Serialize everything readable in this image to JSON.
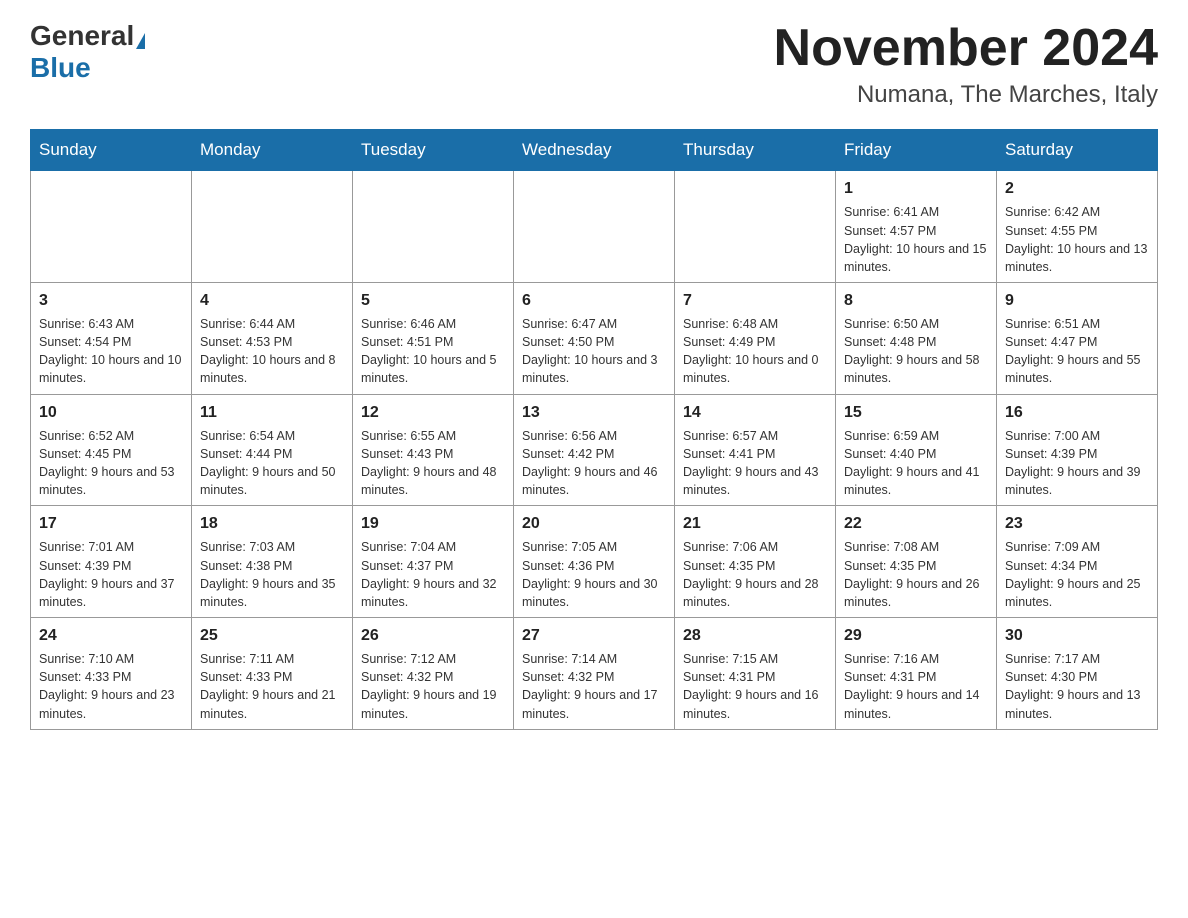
{
  "header": {
    "logo_general": "General",
    "logo_blue": "Blue",
    "month_year": "November 2024",
    "location": "Numana, The Marches, Italy"
  },
  "weekdays": [
    "Sunday",
    "Monday",
    "Tuesday",
    "Wednesday",
    "Thursday",
    "Friday",
    "Saturday"
  ],
  "weeks": [
    [
      {
        "day": "",
        "sunrise": "",
        "sunset": "",
        "daylight": ""
      },
      {
        "day": "",
        "sunrise": "",
        "sunset": "",
        "daylight": ""
      },
      {
        "day": "",
        "sunrise": "",
        "sunset": "",
        "daylight": ""
      },
      {
        "day": "",
        "sunrise": "",
        "sunset": "",
        "daylight": ""
      },
      {
        "day": "",
        "sunrise": "",
        "sunset": "",
        "daylight": ""
      },
      {
        "day": "1",
        "sunrise": "Sunrise: 6:41 AM",
        "sunset": "Sunset: 4:57 PM",
        "daylight": "Daylight: 10 hours and 15 minutes."
      },
      {
        "day": "2",
        "sunrise": "Sunrise: 6:42 AM",
        "sunset": "Sunset: 4:55 PM",
        "daylight": "Daylight: 10 hours and 13 minutes."
      }
    ],
    [
      {
        "day": "3",
        "sunrise": "Sunrise: 6:43 AM",
        "sunset": "Sunset: 4:54 PM",
        "daylight": "Daylight: 10 hours and 10 minutes."
      },
      {
        "day": "4",
        "sunrise": "Sunrise: 6:44 AM",
        "sunset": "Sunset: 4:53 PM",
        "daylight": "Daylight: 10 hours and 8 minutes."
      },
      {
        "day": "5",
        "sunrise": "Sunrise: 6:46 AM",
        "sunset": "Sunset: 4:51 PM",
        "daylight": "Daylight: 10 hours and 5 minutes."
      },
      {
        "day": "6",
        "sunrise": "Sunrise: 6:47 AM",
        "sunset": "Sunset: 4:50 PM",
        "daylight": "Daylight: 10 hours and 3 minutes."
      },
      {
        "day": "7",
        "sunrise": "Sunrise: 6:48 AM",
        "sunset": "Sunset: 4:49 PM",
        "daylight": "Daylight: 10 hours and 0 minutes."
      },
      {
        "day": "8",
        "sunrise": "Sunrise: 6:50 AM",
        "sunset": "Sunset: 4:48 PM",
        "daylight": "Daylight: 9 hours and 58 minutes."
      },
      {
        "day": "9",
        "sunrise": "Sunrise: 6:51 AM",
        "sunset": "Sunset: 4:47 PM",
        "daylight": "Daylight: 9 hours and 55 minutes."
      }
    ],
    [
      {
        "day": "10",
        "sunrise": "Sunrise: 6:52 AM",
        "sunset": "Sunset: 4:45 PM",
        "daylight": "Daylight: 9 hours and 53 minutes."
      },
      {
        "day": "11",
        "sunrise": "Sunrise: 6:54 AM",
        "sunset": "Sunset: 4:44 PM",
        "daylight": "Daylight: 9 hours and 50 minutes."
      },
      {
        "day": "12",
        "sunrise": "Sunrise: 6:55 AM",
        "sunset": "Sunset: 4:43 PM",
        "daylight": "Daylight: 9 hours and 48 minutes."
      },
      {
        "day": "13",
        "sunrise": "Sunrise: 6:56 AM",
        "sunset": "Sunset: 4:42 PM",
        "daylight": "Daylight: 9 hours and 46 minutes."
      },
      {
        "day": "14",
        "sunrise": "Sunrise: 6:57 AM",
        "sunset": "Sunset: 4:41 PM",
        "daylight": "Daylight: 9 hours and 43 minutes."
      },
      {
        "day": "15",
        "sunrise": "Sunrise: 6:59 AM",
        "sunset": "Sunset: 4:40 PM",
        "daylight": "Daylight: 9 hours and 41 minutes."
      },
      {
        "day": "16",
        "sunrise": "Sunrise: 7:00 AM",
        "sunset": "Sunset: 4:39 PM",
        "daylight": "Daylight: 9 hours and 39 minutes."
      }
    ],
    [
      {
        "day": "17",
        "sunrise": "Sunrise: 7:01 AM",
        "sunset": "Sunset: 4:39 PM",
        "daylight": "Daylight: 9 hours and 37 minutes."
      },
      {
        "day": "18",
        "sunrise": "Sunrise: 7:03 AM",
        "sunset": "Sunset: 4:38 PM",
        "daylight": "Daylight: 9 hours and 35 minutes."
      },
      {
        "day": "19",
        "sunrise": "Sunrise: 7:04 AM",
        "sunset": "Sunset: 4:37 PM",
        "daylight": "Daylight: 9 hours and 32 minutes."
      },
      {
        "day": "20",
        "sunrise": "Sunrise: 7:05 AM",
        "sunset": "Sunset: 4:36 PM",
        "daylight": "Daylight: 9 hours and 30 minutes."
      },
      {
        "day": "21",
        "sunrise": "Sunrise: 7:06 AM",
        "sunset": "Sunset: 4:35 PM",
        "daylight": "Daylight: 9 hours and 28 minutes."
      },
      {
        "day": "22",
        "sunrise": "Sunrise: 7:08 AM",
        "sunset": "Sunset: 4:35 PM",
        "daylight": "Daylight: 9 hours and 26 minutes."
      },
      {
        "day": "23",
        "sunrise": "Sunrise: 7:09 AM",
        "sunset": "Sunset: 4:34 PM",
        "daylight": "Daylight: 9 hours and 25 minutes."
      }
    ],
    [
      {
        "day": "24",
        "sunrise": "Sunrise: 7:10 AM",
        "sunset": "Sunset: 4:33 PM",
        "daylight": "Daylight: 9 hours and 23 minutes."
      },
      {
        "day": "25",
        "sunrise": "Sunrise: 7:11 AM",
        "sunset": "Sunset: 4:33 PM",
        "daylight": "Daylight: 9 hours and 21 minutes."
      },
      {
        "day": "26",
        "sunrise": "Sunrise: 7:12 AM",
        "sunset": "Sunset: 4:32 PM",
        "daylight": "Daylight: 9 hours and 19 minutes."
      },
      {
        "day": "27",
        "sunrise": "Sunrise: 7:14 AM",
        "sunset": "Sunset: 4:32 PM",
        "daylight": "Daylight: 9 hours and 17 minutes."
      },
      {
        "day": "28",
        "sunrise": "Sunrise: 7:15 AM",
        "sunset": "Sunset: 4:31 PM",
        "daylight": "Daylight: 9 hours and 16 minutes."
      },
      {
        "day": "29",
        "sunrise": "Sunrise: 7:16 AM",
        "sunset": "Sunset: 4:31 PM",
        "daylight": "Daylight: 9 hours and 14 minutes."
      },
      {
        "day": "30",
        "sunrise": "Sunrise: 7:17 AM",
        "sunset": "Sunset: 4:30 PM",
        "daylight": "Daylight: 9 hours and 13 minutes."
      }
    ]
  ]
}
